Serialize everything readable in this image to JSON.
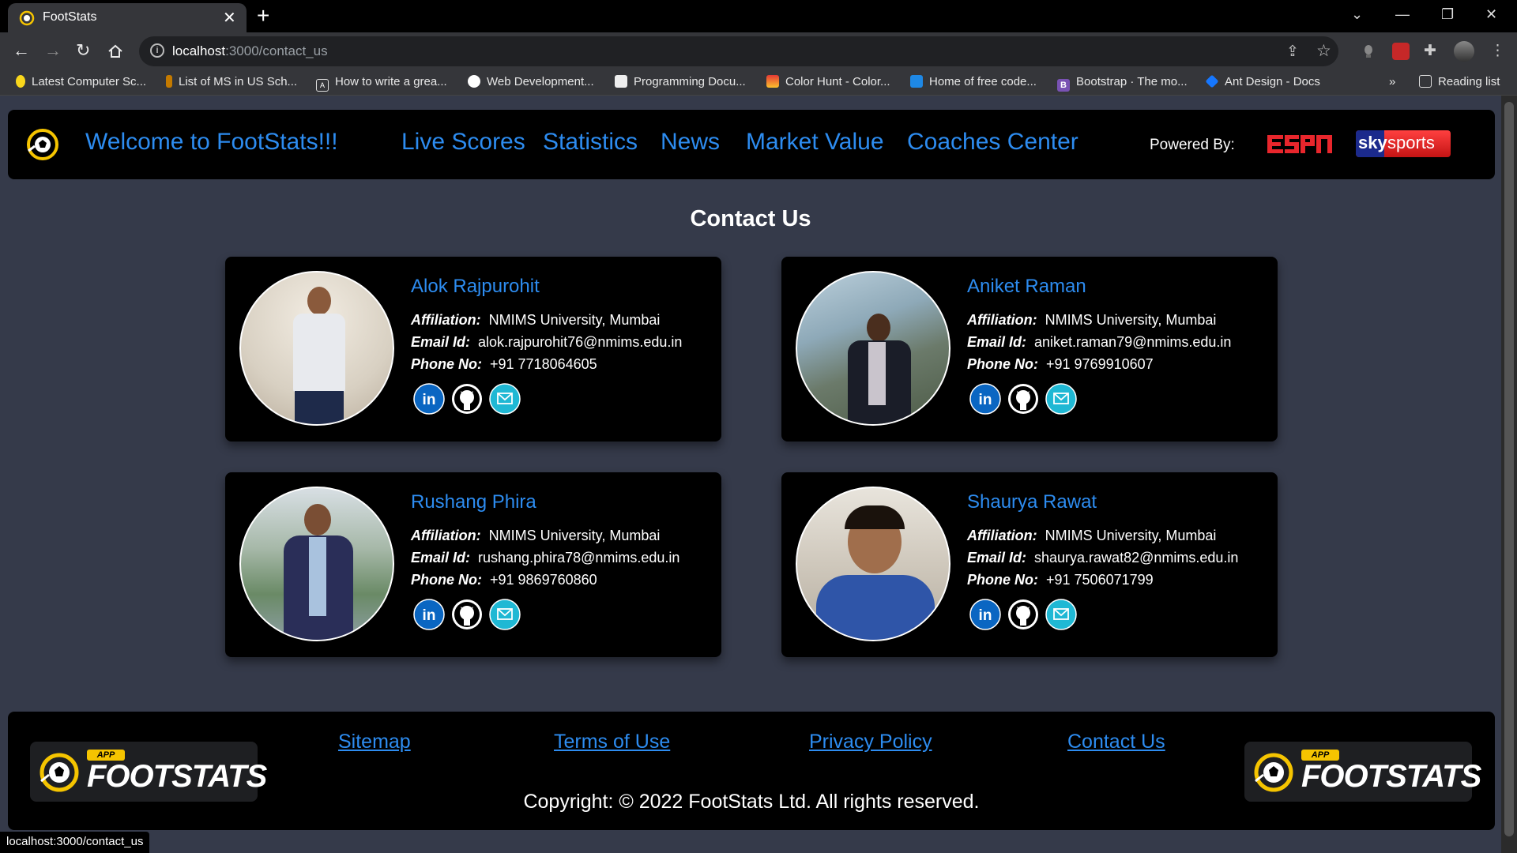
{
  "browser": {
    "tab_title": "FootStats",
    "url_host": "localhost",
    "url_path": ":3000/contact_us",
    "bookmarks": [
      "Latest Computer Sc...",
      "List of MS in US Sch...",
      "How to write a grea...",
      "Web Development...",
      "Programming Docu...",
      "Color Hunt - Color...",
      "Home of free code...",
      "Bootstrap · The mo...",
      "Ant Design - Docs"
    ],
    "bookmarks_more": "»",
    "reading_list": "Reading list",
    "status_url": "localhost:3000/contact_us"
  },
  "nav": {
    "brand": "Welcome to FootStats!!!",
    "links": [
      "Live Scores",
      "Statistics",
      "News",
      "Market Value",
      "Coaches Center"
    ],
    "powered_by": "Powered By:",
    "sky_text": "sky",
    "sports_text": "sports"
  },
  "main": {
    "heading": "Contact Us",
    "labels": {
      "affiliation": "Affiliation:",
      "email": "Email Id:",
      "phone": "Phone No:"
    },
    "contacts": [
      {
        "name": "Alok Rajpurohit",
        "affiliation": "NMIMS University, Mumbai",
        "email": "alok.rajpurohit76@nmims.edu.in",
        "phone": "+91 7718064605"
      },
      {
        "name": "Aniket Raman",
        "affiliation": "NMIMS University, Mumbai",
        "email": "aniket.raman79@nmims.edu.in",
        "phone": "+91 9769910607"
      },
      {
        "name": "Rushang Phira",
        "affiliation": "NMIMS University, Mumbai",
        "email": "rushang.phira78@nmims.edu.in",
        "phone": "+91 9869760860"
      },
      {
        "name": "Shaurya Rawat",
        "affiliation": "NMIMS University, Mumbai",
        "email": "shaurya.rawat82@nmims.edu.in",
        "phone": "+91 7506071799"
      }
    ]
  },
  "footer": {
    "links": [
      "Sitemap",
      "Terms of Use",
      "Privacy Policy",
      "Contact Us"
    ],
    "copyright": "Copyright: © 2022 FootStats Ltd. All rights reserved.",
    "logo_app": "APP",
    "logo_text": "FOOTSTATS"
  },
  "colors": {
    "accent": "#2d8cf0",
    "page_bg": "#353a4a",
    "card_bg": "#000000",
    "logo_yellow": "#f5c400",
    "espn_red": "#e8262c",
    "sky_red": "#e52b2b",
    "linkedin": "#0a66c2",
    "mail": "#1fb8d4"
  }
}
